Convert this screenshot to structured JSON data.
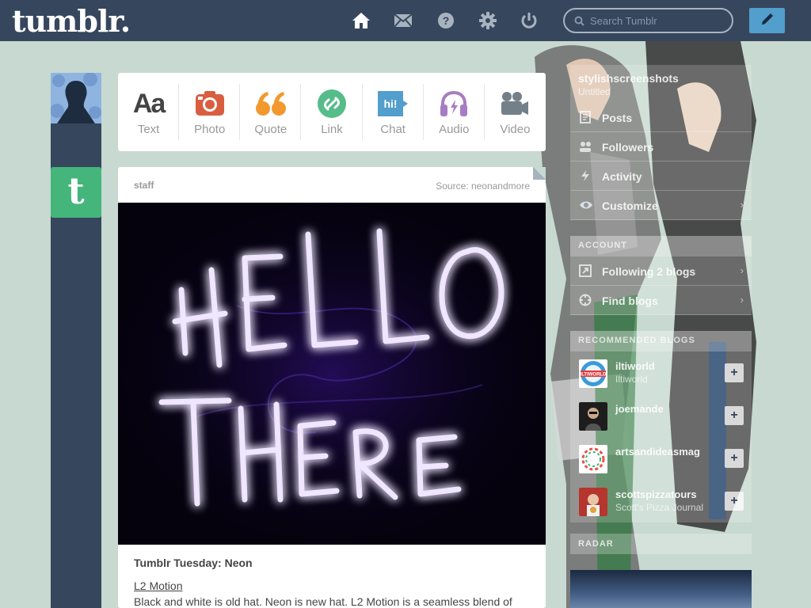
{
  "header": {
    "logo": "tumblr.",
    "search_placeholder": "Search Tumblr",
    "nav_icons": [
      "home-icon",
      "mail-icon",
      "help-icon",
      "settings-icon",
      "power-icon"
    ],
    "compose_icon": "pencil-icon"
  },
  "post_types": [
    {
      "label": "Text",
      "icon": "text-icon",
      "color": "#444444"
    },
    {
      "label": "Photo",
      "icon": "camera-icon",
      "color": "#d95e40"
    },
    {
      "label": "Quote",
      "icon": "quote-icon",
      "color": "#f2992e"
    },
    {
      "label": "Link",
      "icon": "link-icon",
      "color": "#56bc8a"
    },
    {
      "label": "Chat",
      "icon": "chat-icon",
      "color": "#529ecc"
    },
    {
      "label": "Audio",
      "icon": "headphones-icon",
      "color": "#a77dc2"
    },
    {
      "label": "Video",
      "icon": "video-camera-icon",
      "color": "#748089"
    }
  ],
  "post": {
    "author": "staff",
    "source": "Source: neonandmore",
    "image_text": [
      "HELLO",
      "THERE"
    ],
    "title": "Tumblr Tuesday: Neon",
    "link_text": "L2 Motion",
    "body": "Black and white is old hat. Neon is new hat. L2 Motion is a seamless blend of"
  },
  "sidebar": {
    "blog_name": "stylishscreenshots",
    "blog_subtitle": "Untitled",
    "menu": [
      {
        "label": "Posts",
        "icon": "posts-icon"
      },
      {
        "label": "Followers",
        "icon": "followers-icon"
      },
      {
        "label": "Activity",
        "icon": "activity-icon"
      },
      {
        "label": "Customize",
        "icon": "eye-icon"
      }
    ],
    "account_header": "ACCOUNT",
    "account_menu": [
      {
        "label": "Following 2 blogs",
        "icon": "following-icon"
      },
      {
        "label": "Find blogs",
        "icon": "compass-icon"
      }
    ],
    "recommended_header": "RECOMMENDED BLOGS",
    "recommended": [
      {
        "name": "iltiworld",
        "sub": "Iltiworld",
        "avatar_text": "ILTIWORLD"
      },
      {
        "name": "joemande",
        "sub": "",
        "avatar_text": ""
      },
      {
        "name": "artsandideasmag",
        "sub": "",
        "avatar_text": ""
      },
      {
        "name": "scottspizzatours",
        "sub": "Scott's Pizza Journal",
        "avatar_text": ""
      }
    ],
    "radar_header": "RADAR"
  }
}
